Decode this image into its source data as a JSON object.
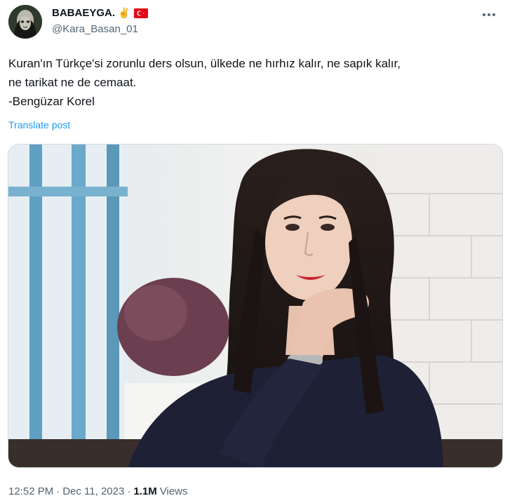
{
  "author": {
    "display_name": "BABAEYGA.",
    "handle": "@Kara_Basan_01",
    "badges": [
      "victory-hand-emoji",
      "turkey-flag"
    ]
  },
  "tweet": {
    "lines": [
      "Kuran'ın Türkçe'si zorunlu ders olsun, ülkede ne hırhız kalır, ne sapık kalır,",
      "ne tarikat ne de cemaat.",
      "-Bengüzar Korel"
    ],
    "translate_label": "Translate post"
  },
  "meta": {
    "time": "12:52 PM",
    "separator": "·",
    "date": "Dec 11, 2023",
    "views_count": "1.1M",
    "views_label": "Views"
  },
  "icons": {
    "more": "more-horizontal-icon"
  },
  "colors": {
    "link": "#1d9bf0",
    "secondary_text": "#536471",
    "primary_text": "#0f1419",
    "flag_red": "#e30a17"
  }
}
